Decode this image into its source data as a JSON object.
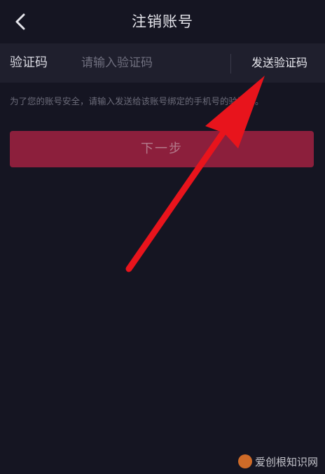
{
  "navbar": {
    "title": "注销账号",
    "back_icon": "chevron-left-icon"
  },
  "verification": {
    "label": "验证码",
    "placeholder": "请输入验证码",
    "value": "",
    "send_label": "发送验证码"
  },
  "hint": "为了您的账号安全，请输入发送给该账号绑定的手机号的验证码。",
  "next_button": "下一步",
  "watermark": "爱创根知识网",
  "colors": {
    "background": "#151522",
    "input_row": "#1f1f2d",
    "primary_button": "#8c1f3c",
    "annotation_arrow": "#e8141c"
  }
}
